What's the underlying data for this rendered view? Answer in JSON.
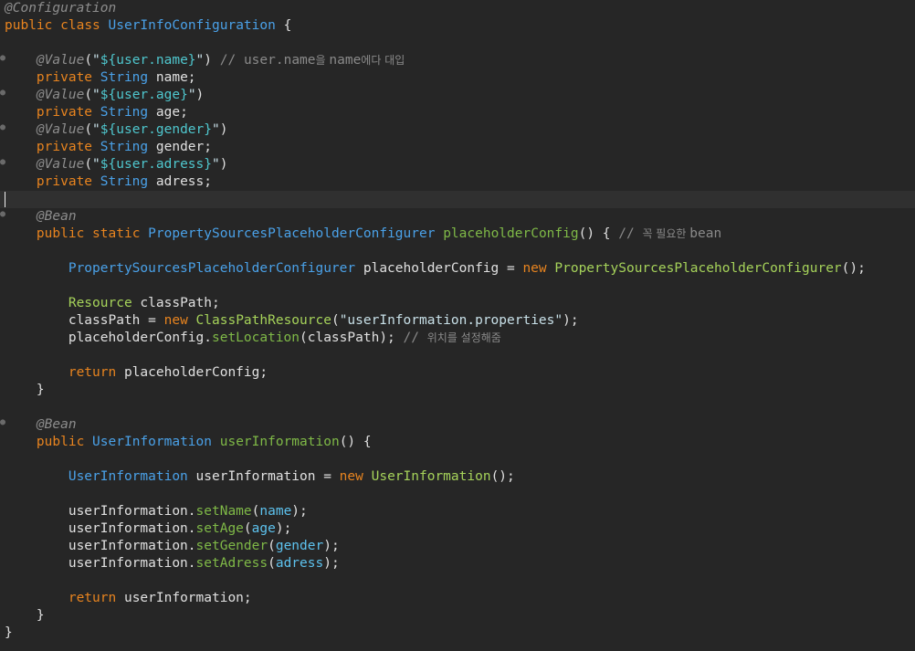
{
  "lines": [
    [
      {
        "t": "@Configuration",
        "c": "ann"
      }
    ],
    [
      {
        "t": "public",
        "c": "kw"
      },
      {
        "t": " "
      },
      {
        "t": "class",
        "c": "kw"
      },
      {
        "t": " "
      },
      {
        "t": "UserInfoConfiguration",
        "c": "ty"
      },
      {
        "t": " {"
      }
    ],
    [],
    [
      {
        "t": "    "
      },
      {
        "t": "@Value",
        "c": "ann"
      },
      {
        "t": "("
      },
      {
        "t": "\"",
        "c": "str"
      },
      {
        "t": "${user.name}",
        "c": "sv"
      },
      {
        "t": "\"",
        "c": "str"
      },
      {
        "t": ") "
      },
      {
        "t": "// user.name",
        "c": "cm"
      },
      {
        "t": "을 ",
        "c": "cmk"
      },
      {
        "t": "name",
        "c": "cm"
      },
      {
        "t": "에다 대입",
        "c": "cmk"
      }
    ],
    [
      {
        "t": "    "
      },
      {
        "t": "private",
        "c": "kw"
      },
      {
        "t": " "
      },
      {
        "t": "String",
        "c": "ty"
      },
      {
        "t": " name;"
      }
    ],
    [
      {
        "t": "    "
      },
      {
        "t": "@Value",
        "c": "ann"
      },
      {
        "t": "("
      },
      {
        "t": "\"",
        "c": "str"
      },
      {
        "t": "${user.age}",
        "c": "sv"
      },
      {
        "t": "\"",
        "c": "str"
      },
      {
        "t": ")"
      }
    ],
    [
      {
        "t": "    "
      },
      {
        "t": "private",
        "c": "kw"
      },
      {
        "t": " "
      },
      {
        "t": "String",
        "c": "ty"
      },
      {
        "t": " age;"
      }
    ],
    [
      {
        "t": "    "
      },
      {
        "t": "@Value",
        "c": "ann"
      },
      {
        "t": "("
      },
      {
        "t": "\"",
        "c": "str"
      },
      {
        "t": "${user.gender}",
        "c": "sv"
      },
      {
        "t": "\"",
        "c": "str"
      },
      {
        "t": ")"
      }
    ],
    [
      {
        "t": "    "
      },
      {
        "t": "private",
        "c": "kw"
      },
      {
        "t": " "
      },
      {
        "t": "String",
        "c": "ty"
      },
      {
        "t": " gender;"
      }
    ],
    [
      {
        "t": "    "
      },
      {
        "t": "@Value",
        "c": "ann"
      },
      {
        "t": "("
      },
      {
        "t": "\"",
        "c": "str"
      },
      {
        "t": "${user.adress}",
        "c": "sv"
      },
      {
        "t": "\"",
        "c": "str"
      },
      {
        "t": ")"
      }
    ],
    [
      {
        "t": "    "
      },
      {
        "t": "private",
        "c": "kw"
      },
      {
        "t": " "
      },
      {
        "t": "String",
        "c": "ty"
      },
      {
        "t": " adress;"
      }
    ],
    [],
    [
      {
        "t": "    "
      },
      {
        "t": "@Bean",
        "c": "ann"
      }
    ],
    [
      {
        "t": "    "
      },
      {
        "t": "public",
        "c": "kw"
      },
      {
        "t": " "
      },
      {
        "t": "static",
        "c": "kw"
      },
      {
        "t": " "
      },
      {
        "t": "PropertySourcesPlaceholderConfigurer",
        "c": "ty"
      },
      {
        "t": " "
      },
      {
        "t": "placeholderConfig",
        "c": "fn"
      },
      {
        "t": "() { "
      },
      {
        "t": "// ",
        "c": "cm"
      },
      {
        "t": "꼭 필요한 ",
        "c": "cmk"
      },
      {
        "t": "bean",
        "c": "cm"
      }
    ],
    [],
    [
      {
        "t": "        "
      },
      {
        "t": "PropertySourcesPlaceholderConfigurer",
        "c": "ty"
      },
      {
        "t": " placeholderConfig = "
      },
      {
        "t": "new",
        "c": "kw"
      },
      {
        "t": " "
      },
      {
        "t": "PropertySourcesPlaceholderConfigurer",
        "c": "rs"
      },
      {
        "t": "();"
      }
    ],
    [],
    [
      {
        "t": "        "
      },
      {
        "t": "Resource",
        "c": "rs"
      },
      {
        "t": " classPath;"
      }
    ],
    [
      {
        "t": "        "
      },
      {
        "t": "classPath = "
      },
      {
        "t": "new",
        "c": "kw"
      },
      {
        "t": " "
      },
      {
        "t": "ClassPathResource",
        "c": "rs"
      },
      {
        "t": "("
      },
      {
        "t": "\"userInformation.properties\"",
        "c": "str"
      },
      {
        "t": ");"
      }
    ],
    [
      {
        "t": "        "
      },
      {
        "t": "placeholderConfig."
      },
      {
        "t": "setLocation",
        "c": "fn"
      },
      {
        "t": "(classPath); "
      },
      {
        "t": "// ",
        "c": "cm"
      },
      {
        "t": "위치를 설정해줌",
        "c": "cmk"
      }
    ],
    [],
    [
      {
        "t": "        "
      },
      {
        "t": "return",
        "c": "kw"
      },
      {
        "t": " placeholderConfig;"
      }
    ],
    [
      {
        "t": "    }"
      }
    ],
    [],
    [
      {
        "t": "    "
      },
      {
        "t": "@Bean",
        "c": "ann"
      }
    ],
    [
      {
        "t": "    "
      },
      {
        "t": "public",
        "c": "kw"
      },
      {
        "t": " "
      },
      {
        "t": "UserInformation",
        "c": "ty"
      },
      {
        "t": " "
      },
      {
        "t": "userInformation",
        "c": "fn"
      },
      {
        "t": "() {"
      }
    ],
    [],
    [
      {
        "t": "        "
      },
      {
        "t": "UserInformation",
        "c": "ty"
      },
      {
        "t": " userInformation = "
      },
      {
        "t": "new",
        "c": "kw"
      },
      {
        "t": " "
      },
      {
        "t": "UserInformation",
        "c": "rs"
      },
      {
        "t": "();"
      }
    ],
    [],
    [
      {
        "t": "        "
      },
      {
        "t": "userInformation."
      },
      {
        "t": "setName",
        "c": "fn"
      },
      {
        "t": "("
      },
      {
        "t": "name",
        "c": "fld"
      },
      {
        "t": ");"
      }
    ],
    [
      {
        "t": "        "
      },
      {
        "t": "userInformation."
      },
      {
        "t": "setAge",
        "c": "fn"
      },
      {
        "t": "("
      },
      {
        "t": "age",
        "c": "fld"
      },
      {
        "t": ");"
      }
    ],
    [
      {
        "t": "        "
      },
      {
        "t": "userInformation."
      },
      {
        "t": "setGender",
        "c": "fn"
      },
      {
        "t": "("
      },
      {
        "t": "gender",
        "c": "fld"
      },
      {
        "t": ");"
      }
    ],
    [
      {
        "t": "        "
      },
      {
        "t": "userInformation."
      },
      {
        "t": "setAdress",
        "c": "fn"
      },
      {
        "t": "("
      },
      {
        "t": "adress",
        "c": "fld"
      },
      {
        "t": ");"
      }
    ],
    [],
    [
      {
        "t": "        "
      },
      {
        "t": "return",
        "c": "kw"
      },
      {
        "t": " userInformation;"
      }
    ],
    [
      {
        "t": "    }"
      }
    ],
    [
      {
        "t": "}"
      }
    ]
  ]
}
